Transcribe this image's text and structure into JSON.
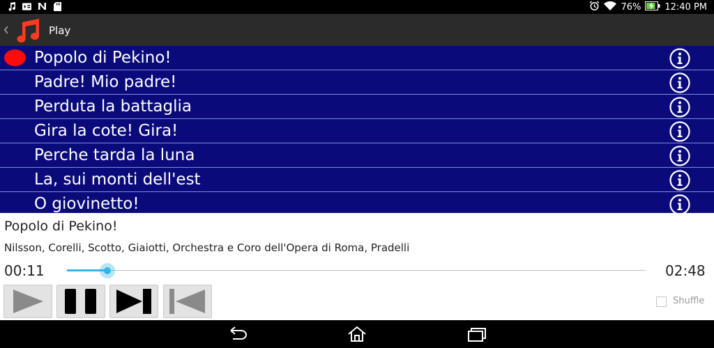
{
  "status_bar": {
    "left_icons": [
      "music-note-icon",
      "media-player-icon",
      "n-icon",
      "sd-card-icon"
    ],
    "battery": "76%",
    "time": "12:40 PM"
  },
  "action_bar": {
    "title": "Play",
    "app_icon": "music-note-icon"
  },
  "tracks": [
    {
      "title": "Popolo di Pekino!",
      "playing": true
    },
    {
      "title": "Padre! Mio padre!",
      "playing": false
    },
    {
      "title": "Perduta la battaglia",
      "playing": false
    },
    {
      "title": "Gira la cote! Gira!",
      "playing": false
    },
    {
      "title": "Perche tarda la luna",
      "playing": false
    },
    {
      "title": "La, sui monti dell'est",
      "playing": false
    },
    {
      "title": "O giovinetto!",
      "playing": false
    }
  ],
  "now_playing": {
    "title": "Popolo di Pekino!",
    "artist": "Nilsson, Corelli, Scotto, Giaiotti, Orchestra e Coro dell'Opera di Roma, Pradelli",
    "current_time": "00:11",
    "total_time": "02:48",
    "progress_fraction": 0.07
  },
  "controls": [
    "play-button",
    "pause-button",
    "next-button",
    "previous-button"
  ],
  "shuffle": {
    "label": "Shuffle",
    "checked": false
  },
  "colors": {
    "list_background": "#0a0a7a",
    "playing_indicator": "#ff0a0a",
    "seek_accent": "#33b5e5"
  }
}
